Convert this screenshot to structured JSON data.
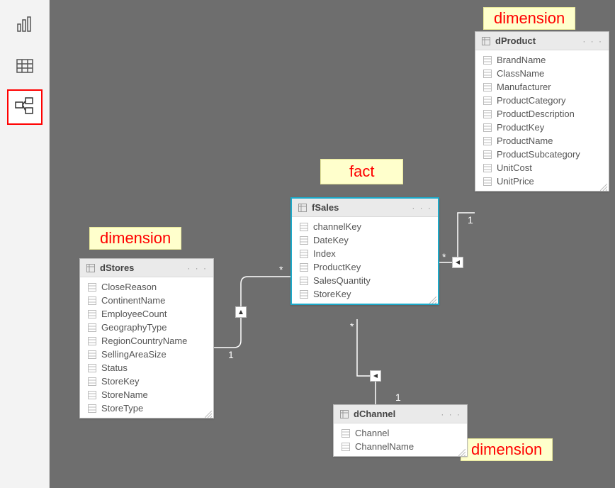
{
  "sidebar": {
    "report_view": "Report view",
    "data_view": "Data view",
    "model_view": "Model view"
  },
  "annotations": {
    "dim_top": "dimension",
    "fact": "fact",
    "dim_left": "dimension",
    "dim_bottom": "dimension"
  },
  "tables": {
    "dProduct": {
      "name": "dProduct",
      "fields": [
        "BrandName",
        "ClassName",
        "Manufacturer",
        "ProductCategory",
        "ProductDescription",
        "ProductKey",
        "ProductName",
        "ProductSubcategory",
        "UnitCost",
        "UnitPrice"
      ]
    },
    "fSales": {
      "name": "fSales",
      "fields": [
        "channelKey",
        "DateKey",
        "Index",
        "ProductKey",
        "SalesQuantity",
        "StoreKey"
      ]
    },
    "dStores": {
      "name": "dStores",
      "fields": [
        "CloseReason",
        "ContinentName",
        "EmployeeCount",
        "GeographyType",
        "RegionCountryName",
        "SellingAreaSize",
        "Status",
        "StoreKey",
        "StoreName",
        "StoreType"
      ]
    },
    "dChannel": {
      "name": "dChannel",
      "fields": [
        "Channel",
        "ChannelName"
      ]
    }
  },
  "cardinality": {
    "many": "*",
    "one": "1"
  },
  "menu_dots": "· · ·"
}
